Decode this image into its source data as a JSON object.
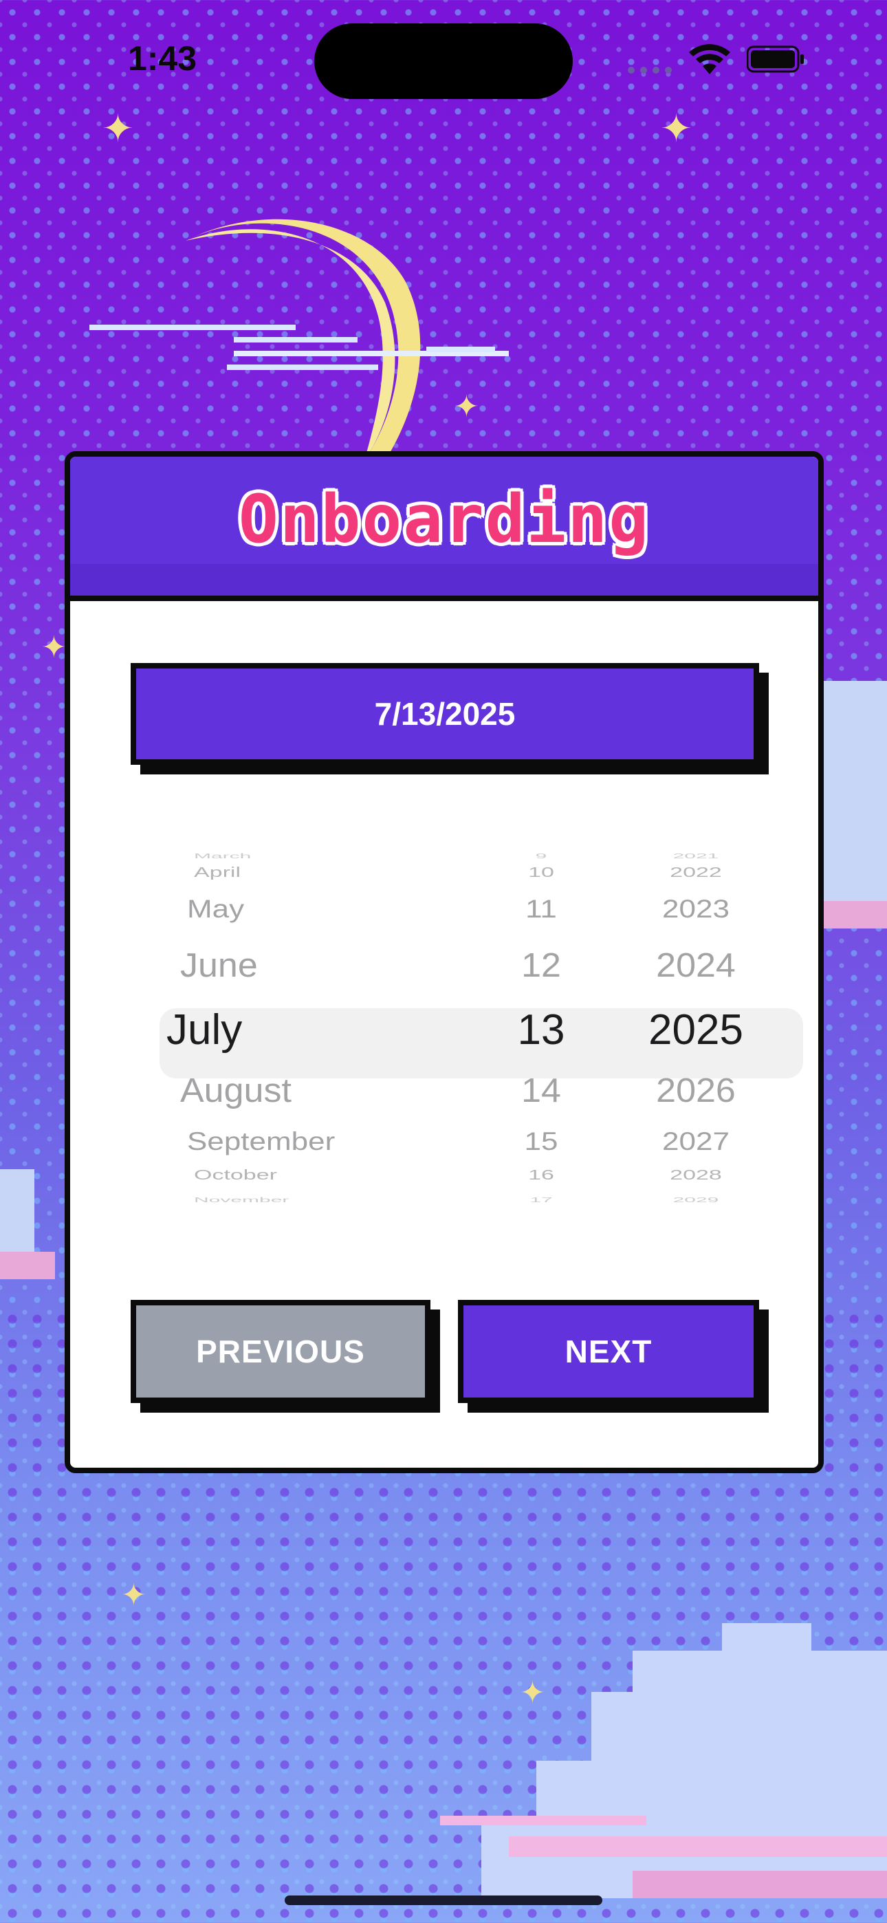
{
  "status_bar": {
    "time": "1:43"
  },
  "modal": {
    "title": "Onboarding",
    "selected_date": "7/13/2025"
  },
  "picker": {
    "months": [
      "March",
      "April",
      "May",
      "June",
      "July",
      "August",
      "September",
      "October",
      "November"
    ],
    "days": [
      "9",
      "10",
      "11",
      "12",
      "13",
      "14",
      "15",
      "16",
      "17"
    ],
    "years": [
      "2021",
      "2022",
      "2023",
      "2024",
      "2025",
      "2026",
      "2027",
      "2028",
      "2029"
    ],
    "selected_index": 4
  },
  "buttons": {
    "previous_label": "PREVIOUS",
    "next_label": "NEXT"
  },
  "colors": {
    "accent": "#6232dc",
    "title": "#f23a7a",
    "previous_button": "#9aa1ad"
  }
}
